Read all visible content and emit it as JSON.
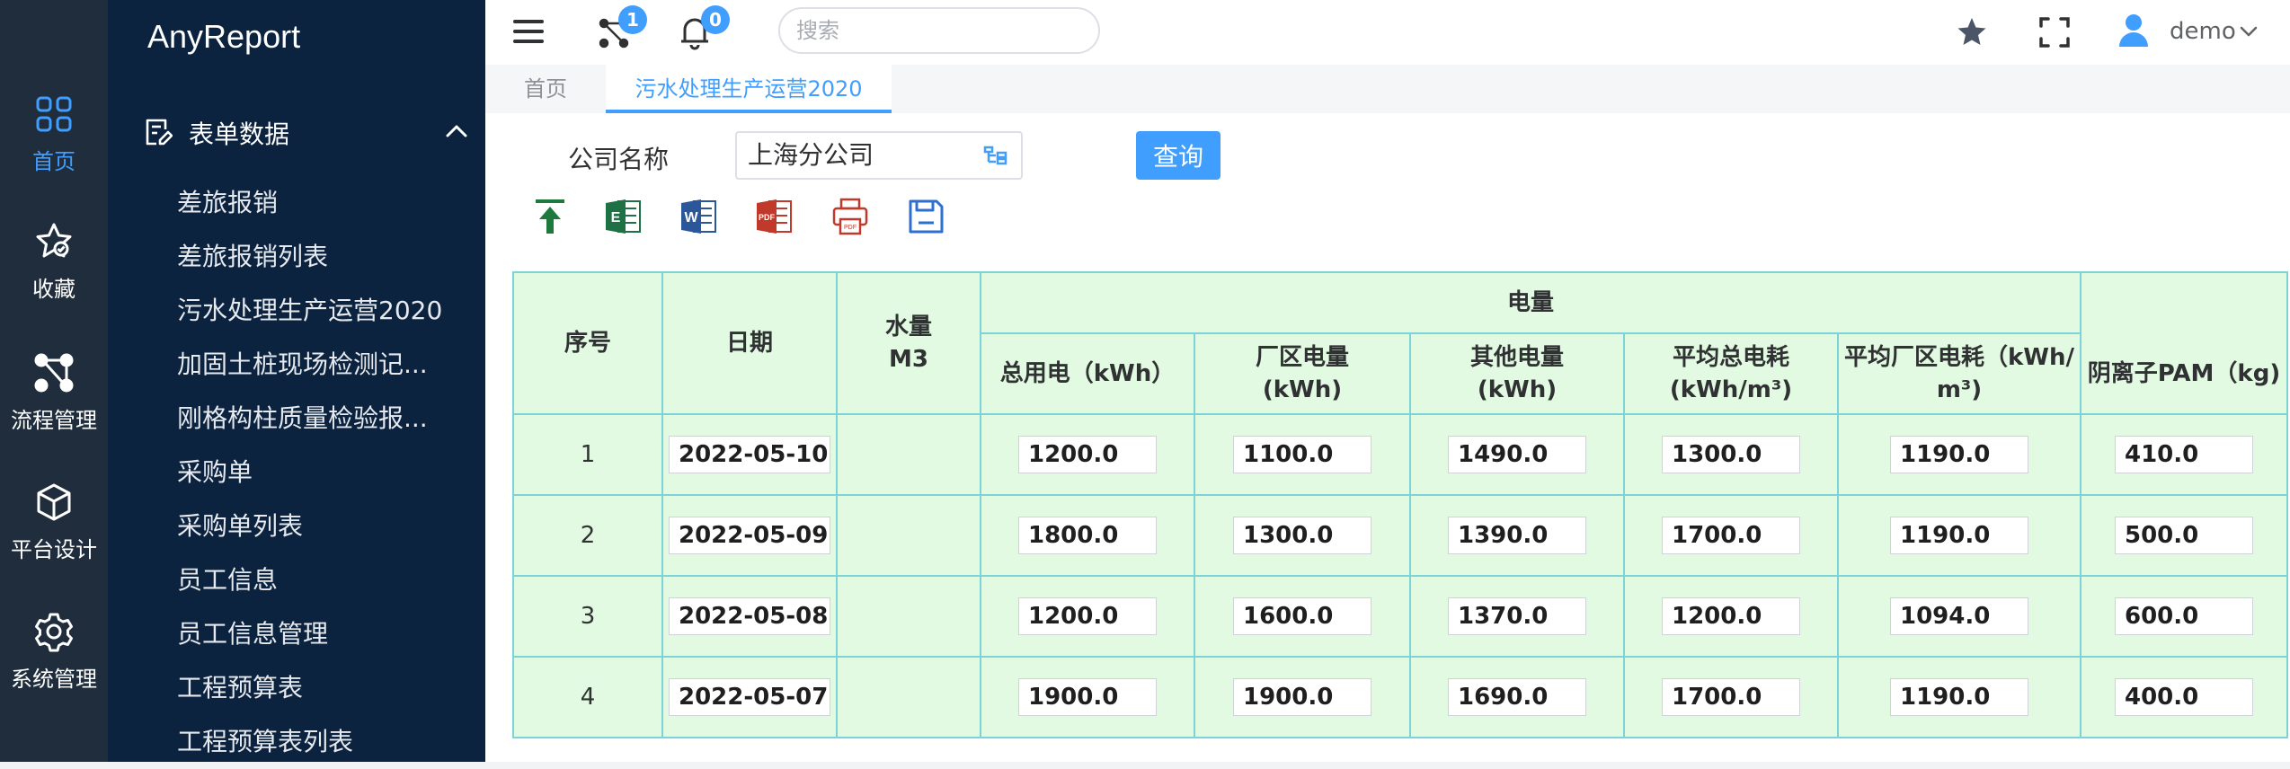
{
  "app": {
    "title": "AnyReport"
  },
  "rail": [
    {
      "label": "首页",
      "icon": "grid-icon",
      "active": true
    },
    {
      "label": "收藏",
      "icon": "star-icon"
    },
    {
      "label": "流程管理",
      "icon": "flow-icon"
    },
    {
      "label": "平台设计",
      "icon": "cube-icon"
    },
    {
      "label": "系统管理",
      "icon": "gear-icon"
    }
  ],
  "menu": {
    "group_label": "表单数据",
    "items": [
      "差旅报销",
      "差旅报销列表",
      "污水处理生产运营2020",
      "加固土桩现场检测记...",
      "刚格构柱质量检验报...",
      "采购单",
      "采购单列表",
      "员工信息",
      "员工信息管理",
      "工程预算表",
      "工程预算表列表"
    ]
  },
  "topbar": {
    "flow_badge": "1",
    "notify_badge": "0",
    "search_placeholder": "搜索",
    "user_name": "demo"
  },
  "tabs": [
    {
      "label": "首页"
    },
    {
      "label": "污水处理生产运营2020",
      "active": true
    }
  ],
  "form": {
    "company_label": "公司名称",
    "company_value": "上海分公司",
    "query_label": "查询"
  },
  "toolbar": [
    "upload-icon",
    "excel-icon",
    "word-icon",
    "pdf-icon",
    "print-icon",
    "save-icon"
  ],
  "table": {
    "headers": {
      "seq": "序号",
      "date": "日期",
      "water": "水量\nM3",
      "power_group": "电量",
      "total_power": "总用电（kWh）",
      "plant_power": "厂区电量\n(kWh)",
      "other_power": "其他电量\n(kWh)",
      "avg_total": "平均总电耗\n(kWh/m³)",
      "avg_plant": "平均厂区电耗（kWh/\nm³)",
      "pam": "阴离子PAM（kg)"
    },
    "rows": [
      {
        "seq": "1",
        "date": "2022-05-10",
        "total": "1200.0",
        "plant": "1100.0",
        "other": "1490.0",
        "avg_total": "1300.0",
        "avg_plant": "1190.0",
        "pam": "410.0"
      },
      {
        "seq": "2",
        "date": "2022-05-09",
        "total": "1800.0",
        "plant": "1300.0",
        "other": "1390.0",
        "avg_total": "1700.0",
        "avg_plant": "1190.0",
        "pam": "500.0"
      },
      {
        "seq": "3",
        "date": "2022-05-08",
        "total": "1200.0",
        "plant": "1600.0",
        "other": "1370.0",
        "avg_total": "1200.0",
        "avg_plant": "1094.0",
        "pam": "600.0"
      },
      {
        "seq": "4",
        "date": "2022-05-07",
        "total": "1900.0",
        "plant": "1900.0",
        "other": "1690.0",
        "avg_total": "1700.0",
        "avg_plant": "1190.0",
        "pam": "400.0"
      }
    ]
  }
}
